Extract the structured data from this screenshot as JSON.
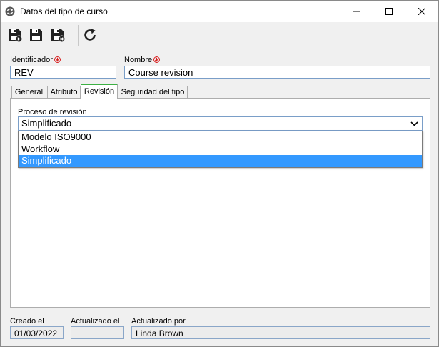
{
  "window": {
    "title": "Datos del tipo de curso",
    "accent": "#3cb043",
    "selection_color": "#3399ff"
  },
  "titlebar_buttons": [
    "minimize-icon",
    "maximize-icon",
    "close-icon"
  ],
  "toolbar": {
    "buttons": [
      "save-and-new-icon",
      "save-icon",
      "save-and-close-icon",
      "refresh-icon"
    ]
  },
  "form": {
    "identifier_label": "Identificador",
    "identifier_value": "REV",
    "name_label": "Nombre",
    "name_value": "Course revision",
    "required_marker": "required-asterisk-icon"
  },
  "tabs": [
    {
      "label": "General",
      "active": false
    },
    {
      "label": "Atributo",
      "active": false
    },
    {
      "label": "Revisión",
      "active": true
    },
    {
      "label": "Seguridad del tipo",
      "active": false
    }
  ],
  "revision": {
    "process_label": "Proceso de revisión",
    "process_value": "Simplificado",
    "options": [
      {
        "label": "Modelo ISO9000",
        "selected": false
      },
      {
        "label": "Workflow",
        "selected": false
      },
      {
        "label": "Simplificado",
        "selected": true
      }
    ]
  },
  "footer": {
    "created_label": "Creado el",
    "created_value": "01/03/2022",
    "updated_label": "Actualizado el",
    "updated_value": "",
    "updated_by_label": "Actualizado por",
    "updated_by_value": "Linda Brown"
  }
}
